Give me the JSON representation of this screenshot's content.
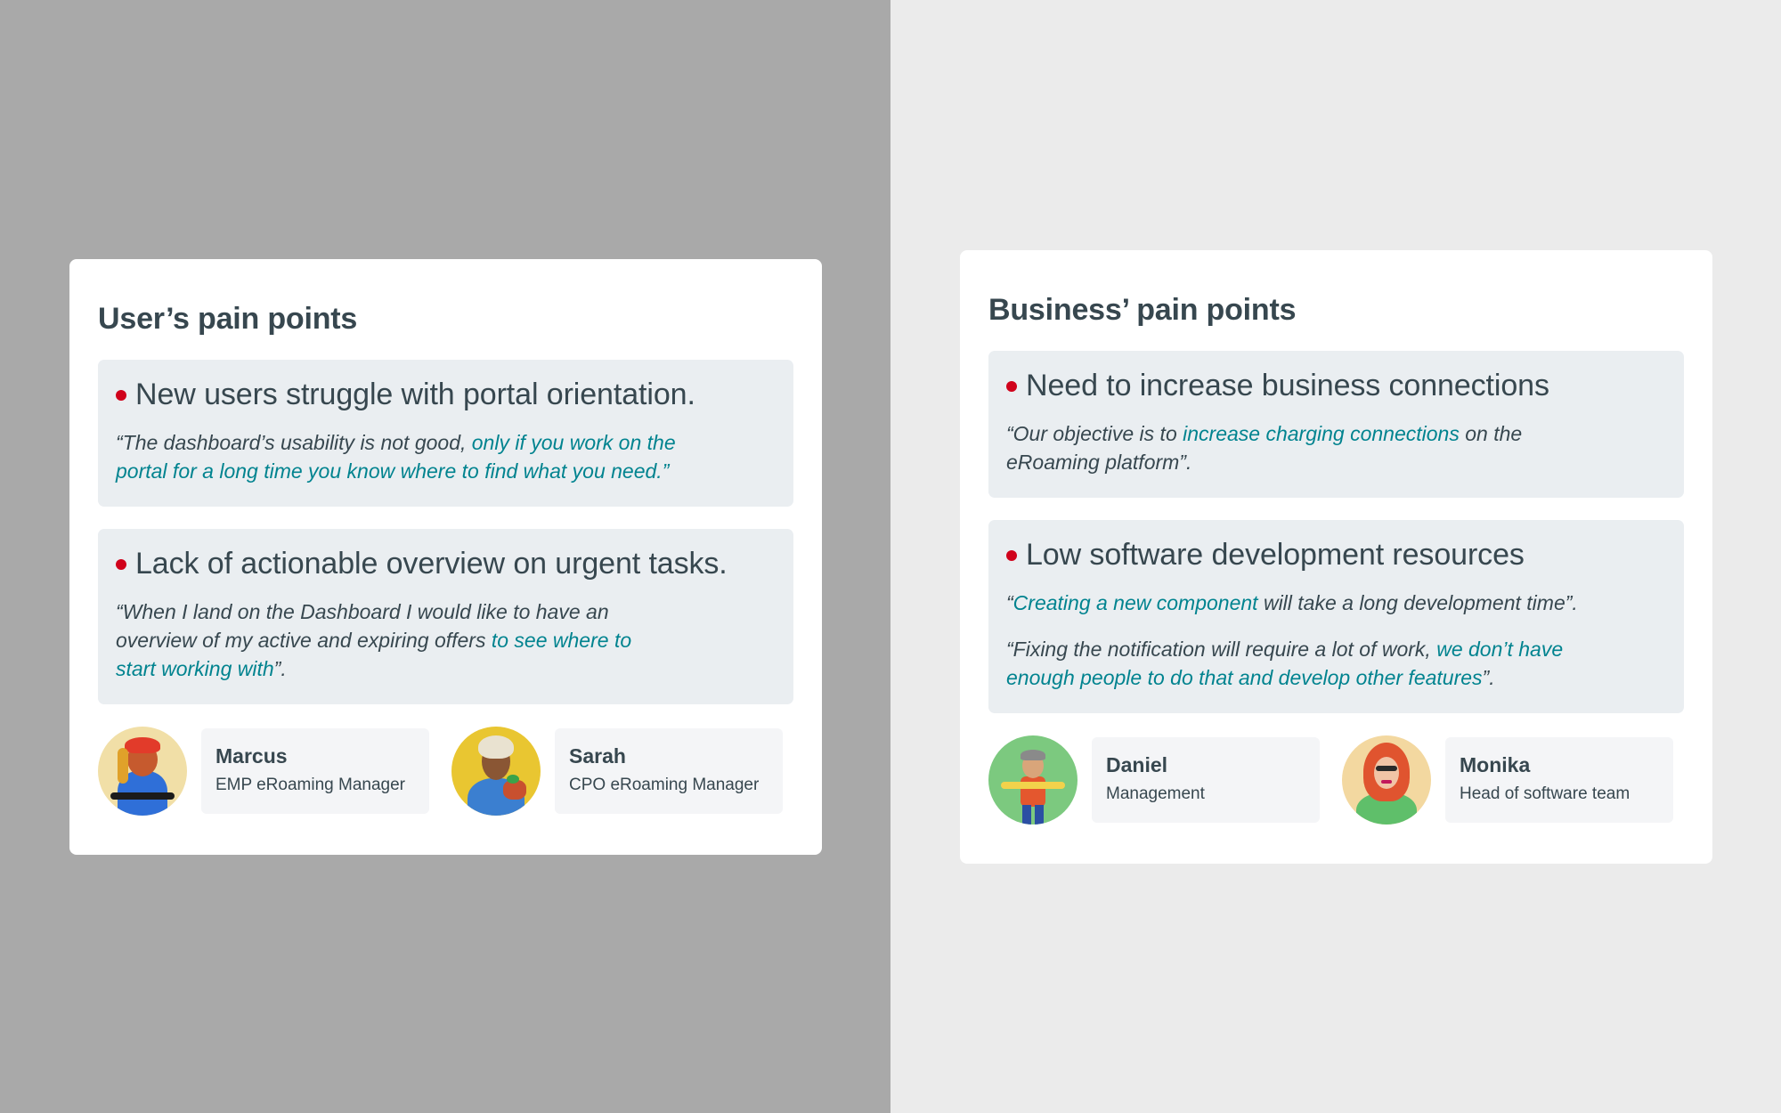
{
  "left_card": {
    "title": "User’s pain points",
    "points": [
      {
        "heading": "New users struggle with portal orientation.",
        "quotes": [
          {
            "plain_before": "“The dashboard’s usability is not good, ",
            "highlight": "only if you work on the portal for a long time you know where to find what you need.”",
            "plain_after": ""
          }
        ]
      },
      {
        "heading": "Lack of actionable overview on urgent tasks.",
        "quotes": [
          {
            "plain_before": "“When I land on the Dashboard I would like to have an overview of my active and expiring offers ",
            "highlight": "to see where to start working with",
            "plain_after": "”."
          }
        ]
      }
    ],
    "personas": [
      {
        "name": "Marcus",
        "role": "EMP eRoaming Manager",
        "avatar_icon": "person-illustration-icon"
      },
      {
        "name": "Sarah",
        "role": "CPO eRoaming Manager",
        "avatar_icon": "person-illustration-icon"
      }
    ]
  },
  "right_card": {
    "title": "Business’ pain points",
    "points": [
      {
        "heading": "Need to increase business connections",
        "quotes": [
          {
            "plain_before": "“Our objective is to ",
            "highlight": "increase charging connections",
            "plain_after": " on the eRoaming platform”."
          }
        ]
      },
      {
        "heading": "Low software development resources",
        "quotes": [
          {
            "plain_before": "“",
            "highlight": "Creating a new component",
            "plain_after": " will take a long development time”."
          },
          {
            "plain_before": "“Fixing the notification will require a lot of work, ",
            "highlight": "we don’t have enough people to do that and develop other features",
            "plain_after": "”."
          }
        ]
      }
    ],
    "personas": [
      {
        "name": "Daniel",
        "role": "Management",
        "avatar_icon": "person-illustration-icon"
      },
      {
        "name": "Monika",
        "role": "Head of software team",
        "avatar_icon": "person-illustration-icon"
      }
    ]
  },
  "colors": {
    "left_background": "#a9a9a9",
    "right_background": "#ebebeb",
    "card": "#ffffff",
    "point_box": "#eaeef1",
    "text": "#37474f",
    "highlight": "#00838f",
    "bullet": "#d0021b"
  }
}
